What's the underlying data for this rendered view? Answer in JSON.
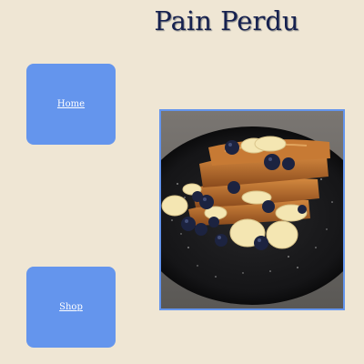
{
  "header": {
    "title": "Pain Perdu"
  },
  "nav": {
    "home_label": "Home",
    "shop_label": "Shop"
  },
  "photo": {
    "alt": "French toast stacked with bananas and blueberries"
  },
  "colors": {
    "background": "#efe6d4",
    "button": "#6495ed",
    "title": "#16214f",
    "frame": "#6495ed"
  }
}
